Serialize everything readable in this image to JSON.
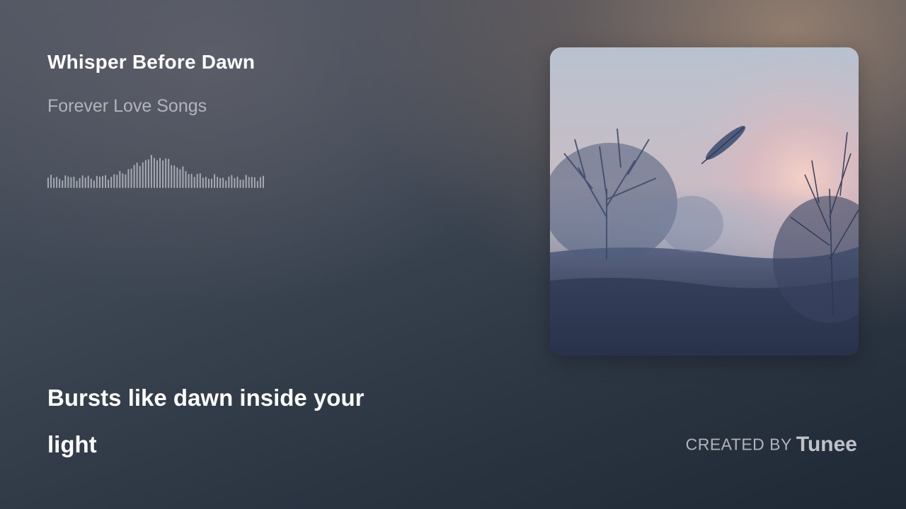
{
  "track": {
    "title": "Whisper Before Dawn",
    "artist": "Forever Love Songs"
  },
  "lyrics": {
    "lines": [
      "Bursts like dawn inside your",
      "light"
    ]
  },
  "credit": {
    "prefix": "CREATED BY",
    "brand": "Tunee"
  },
  "cover_art": {
    "subject": "misty meadow at dawn with bare trees and a floating feather"
  },
  "colors": {
    "text_primary": "#ffffff",
    "text_secondary": "#c9cbd2",
    "waveform": "#e1e4eb"
  }
}
